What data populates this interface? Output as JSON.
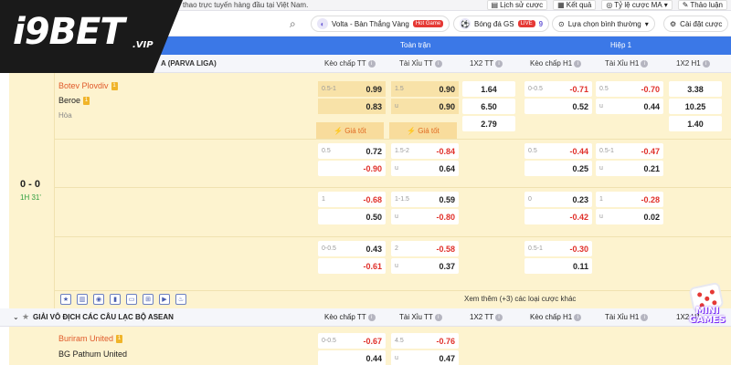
{
  "topbar": {
    "marquee": "thao trực tuyến hàng đầu tại Việt Nam.",
    "links": [
      "Lịch sử cược",
      "Kết quả",
      "Tỷ lệ cược MA",
      "Thảo luận"
    ]
  },
  "nav": {
    "pill1": "Volta - Bàn Thắng Vàng",
    "pill1_badge": "Hot Game",
    "pill2": "Bóng đá GS",
    "pill2_badge": "LIVE",
    "pill2_count": "9",
    "sort": "Lựa chọn bình thường",
    "settings": "Cài đặt cược"
  },
  "logo": {
    "main": "i9BET",
    "sub": ".VIP"
  },
  "header": {
    "full_time": "Toàn trận",
    "first_half": "Hiệp 1",
    "league_partial": "A (PARVA LIGA)",
    "cols": [
      "Kèo chấp TT",
      "Tài Xỉu TT",
      "1X2 TT",
      "Kèo chấp H1",
      "Tài Xỉu H1",
      "1X2 H1"
    ]
  },
  "match": {
    "home": "Botev Plovdiv",
    "away": "Beroe",
    "draw": "Hòa",
    "home_card": "1",
    "away_card": "1",
    "score": "0 - 0",
    "time": "1H 31'",
    "good_price": "Giá tốt",
    "rows": [
      {
        "hdp_tt": [
          [
            "0.5-1",
            "0.99",
            ""
          ],
          [
            "",
            "0.83",
            ""
          ]
        ],
        "ou_tt": [
          [
            "1.5",
            "0.90",
            ""
          ],
          [
            "u",
            "0.90",
            ""
          ]
        ],
        "x12_tt": [
          "1.64",
          "6.50",
          "2.79"
        ],
        "hdp_h1": [
          [
            "0-0.5",
            "-0.71",
            "neg"
          ],
          [
            "",
            "0.52",
            ""
          ]
        ],
        "ou_h1": [
          [
            "0.5",
            "-0.70",
            "neg"
          ],
          [
            "u",
            "0.44",
            ""
          ]
        ],
        "x12_h1": [
          "3.38",
          "10.25",
          "1.40"
        ]
      },
      {
        "hdp_tt": [
          [
            "0.5",
            "0.72",
            ""
          ],
          [
            "",
            "-0.90",
            "neg"
          ]
        ],
        "ou_tt": [
          [
            "1.5-2",
            "-0.84",
            "neg"
          ],
          [
            "u",
            "0.64",
            ""
          ]
        ],
        "hdp_h1": [
          [
            "0.5",
            "-0.44",
            "neg"
          ],
          [
            "",
            "0.25",
            ""
          ]
        ],
        "ou_h1": [
          [
            "0.5-1",
            "-0.47",
            "neg"
          ],
          [
            "u",
            "0.21",
            ""
          ]
        ]
      },
      {
        "hdp_tt": [
          [
            "1",
            "-0.68",
            "neg"
          ],
          [
            "",
            "0.50",
            ""
          ]
        ],
        "ou_tt": [
          [
            "1-1.5",
            "0.59",
            ""
          ],
          [
            "u",
            "-0.80",
            "neg"
          ]
        ],
        "hdp_h1": [
          [
            "0",
            "0.23",
            ""
          ],
          [
            "",
            "-0.42",
            "neg"
          ]
        ],
        "ou_h1": [
          [
            "1",
            "-0.28",
            "neg"
          ],
          [
            "u",
            "0.02",
            ""
          ]
        ]
      },
      {
        "hdp_tt": [
          [
            "0-0.5",
            "0.43",
            ""
          ],
          [
            "",
            "-0.61",
            "neg"
          ]
        ],
        "ou_tt": [
          [
            "2",
            "-0.58",
            "neg"
          ],
          [
            "u",
            "0.37",
            ""
          ]
        ],
        "hdp_h1": [
          [
            "0.5-1",
            "-0.30",
            "neg"
          ],
          [
            "",
            "0.11",
            ""
          ]
        ],
        "ou_h1": [
          [
            "",
            "",
            ""
          ],
          [
            "",
            "",
            ""
          ]
        ]
      }
    ],
    "more": "Xem thêm (+3) các loại cược khác"
  },
  "league2": {
    "name": "GIẢI VÔ ĐỊCH CÁC CÂU LẠC BỘ ASEAN",
    "home": "Buriram United",
    "away": "BG Pathum United",
    "home_card": "1",
    "hdp": [
      [
        "0-0.5",
        "-0.67",
        "neg"
      ],
      [
        "",
        "0.44",
        ""
      ]
    ],
    "ou": [
      [
        "4.5",
        "-0.76",
        "neg"
      ],
      [
        "u",
        "0.47",
        ""
      ]
    ]
  },
  "minigames": "MINI GAMES",
  "colors": {
    "accent": "#3b78e7",
    "row_bg": "#fdf3cf",
    "negative": "#e0302a",
    "positive_team": "#e05a2a"
  }
}
